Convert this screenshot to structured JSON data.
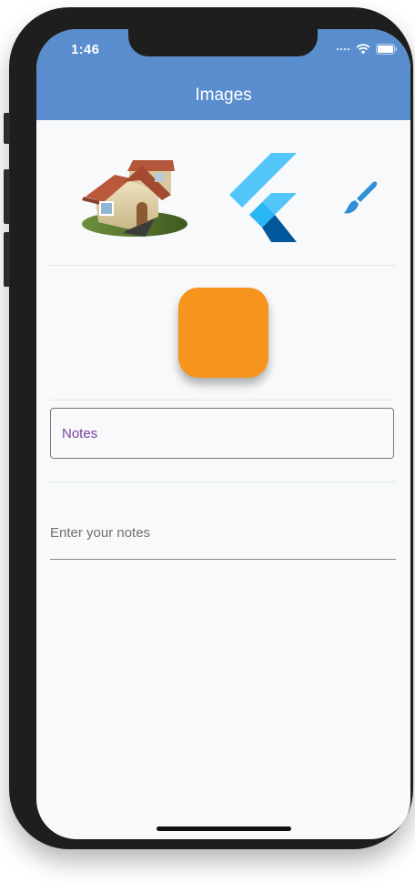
{
  "status_bar": {
    "time": "1:46",
    "icons": [
      "signal-dots-icon",
      "wifi-icon",
      "battery-icon"
    ]
  },
  "app_bar": {
    "title": "Images",
    "color": "#598dcd"
  },
  "images": [
    {
      "name": "house-image"
    },
    {
      "name": "flutter-logo-icon"
    },
    {
      "name": "paint-brush-icon"
    }
  ],
  "orange_box": {
    "color": "#f7941e"
  },
  "notes_field": {
    "label": "Notes",
    "label_color": "#7b3f9c"
  },
  "notes_input": {
    "placeholder": "Enter your notes",
    "value": ""
  }
}
